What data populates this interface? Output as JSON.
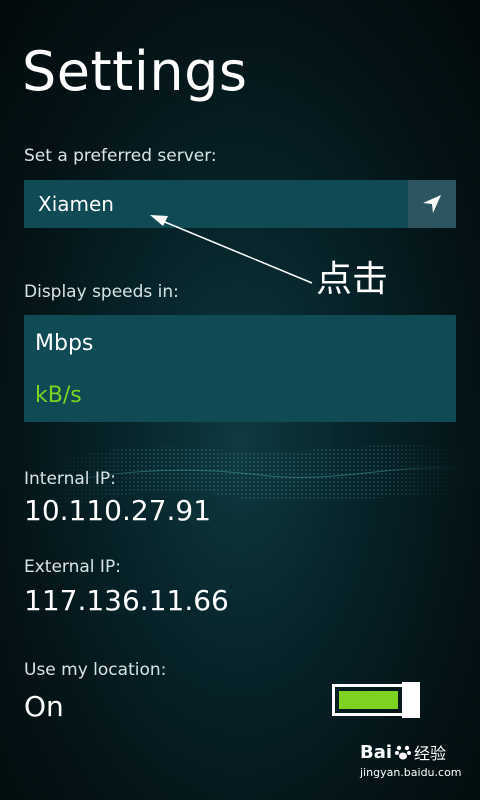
{
  "page": {
    "title": "Settings"
  },
  "server": {
    "label": "Set a preferred server:",
    "selected": "Xiamen",
    "locate_icon": "navigation-arrow-icon"
  },
  "speeds": {
    "label": "Display speeds in:",
    "options": [
      "Mbps",
      "kB/s"
    ],
    "selected": "kB/s",
    "selected_color": "#7ed321"
  },
  "internal_ip": {
    "label": "Internal IP:",
    "value": "10.110.27.91"
  },
  "external_ip": {
    "label": "External  IP:",
    "value": "117.136.11.66"
  },
  "location": {
    "label": "Use my location:",
    "value": "On",
    "toggle_on": true,
    "toggle_color": "#7ed321"
  },
  "annotation": {
    "text": "点击"
  },
  "watermark": {
    "brand": "Bai",
    "brand2": "经验",
    "url": "jingyan.baidu.com"
  }
}
